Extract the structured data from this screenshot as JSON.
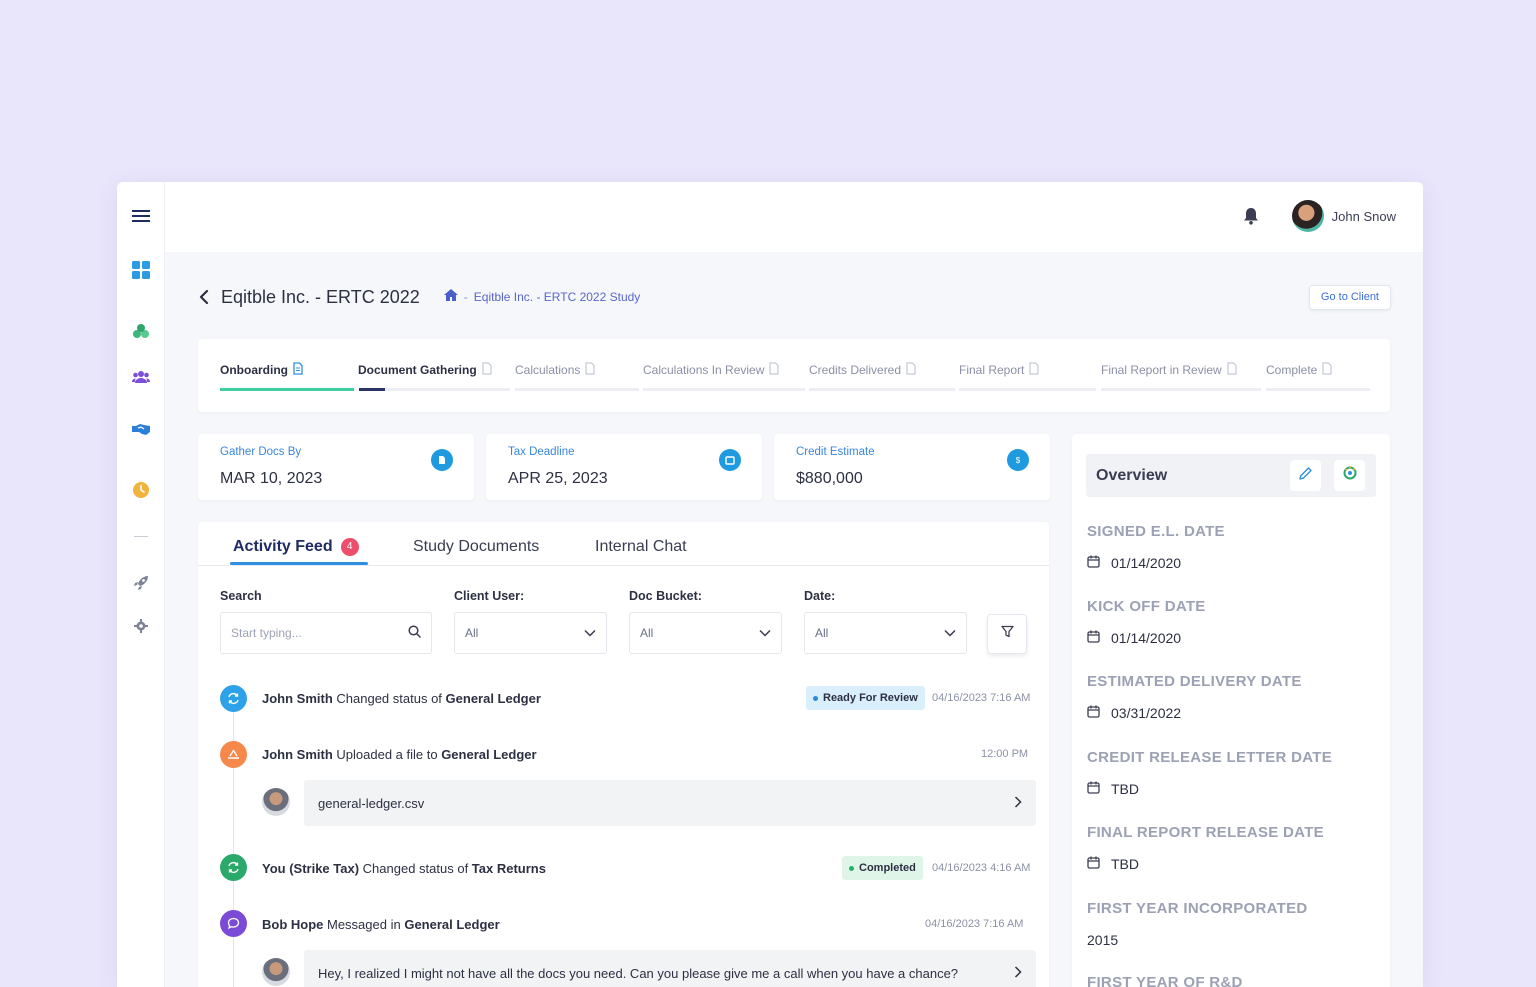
{
  "user": {
    "name": "John Snow"
  },
  "page": {
    "title": "Eqitble Inc. - ERTC 2022",
    "breadcrumb_sep": "-",
    "breadcrumb_link": "Eqitble Inc. - ERTC 2022 Study",
    "go_to_client": "Go to Client"
  },
  "sidebar": {
    "items": [
      "menu-icon",
      "dashboard-icon",
      "money-icon",
      "users-icon",
      "handshake-icon",
      "clock-icon",
      "rocket-icon",
      "settings-icon"
    ]
  },
  "stepper": {
    "steps": [
      {
        "label": "Onboarding",
        "state": "complete",
        "progress": 1.0
      },
      {
        "label": "Document Gathering",
        "state": "active",
        "progress": 0.17
      },
      {
        "label": "Calculations",
        "state": "pending",
        "progress": 0
      },
      {
        "label": "Calculations In Review",
        "state": "pending",
        "progress": 0
      },
      {
        "label": "Credits Delivered",
        "state": "pending",
        "progress": 0
      },
      {
        "label": "Final Report",
        "state": "pending",
        "progress": 0
      },
      {
        "label": "Final Report in Review",
        "state": "pending",
        "progress": 0
      },
      {
        "label": "Complete",
        "state": "pending",
        "progress": 0
      }
    ]
  },
  "cards": [
    {
      "label": "Gather Docs By",
      "value": "MAR 10, 2023",
      "icon": "document-icon"
    },
    {
      "label": "Tax Deadline",
      "value": "APR 25, 2023",
      "icon": "calendar-icon"
    },
    {
      "label": "Credit Estimate",
      "value": "$880,000",
      "icon": "dollar-icon",
      "icon_text": "$"
    }
  ],
  "feed": {
    "tabs": [
      {
        "label": "Activity Feed",
        "count": "4",
        "active": true
      },
      {
        "label": "Study Documents"
      },
      {
        "label": "Internal Chat"
      }
    ],
    "filters": {
      "search_label": "Search",
      "search_placeholder": "Start typing...",
      "client_user_label": "Client User:",
      "client_user_value": "All",
      "doc_bucket_label": "Doc Bucket:",
      "doc_bucket_value": "All",
      "date_label": "Date:",
      "date_value": "All"
    },
    "entries": [
      {
        "actor": "John Smith",
        "action": " Changed status of ",
        "target": "General Ledger",
        "status": "Ready For Review",
        "time": "04/16/2023 7:16 AM",
        "color": "#2ea2e8"
      },
      {
        "actor": "John Smith",
        "action": " Uploaded a file to ",
        "target": "General Ledger",
        "time": "12:00 PM",
        "attachment": "general-ledger.csv",
        "color": "#f5884a"
      },
      {
        "actor": "You (Strike Tax)",
        "action": " Changed status of ",
        "target": "Tax Returns",
        "status": "Completed",
        "time": "04/16/2023 4:16 AM",
        "color": "#2aa96a"
      },
      {
        "actor": "Bob Hope",
        "action": " Messaged in ",
        "target": "General Ledger",
        "time": "04/16/2023 7:16 AM",
        "message": "Hey, I realized I might not have all the docs you need. Can you please give me a call when you have a chance?",
        "color": "#7a4bd6"
      }
    ]
  },
  "overview": {
    "title": "Overview",
    "fields": [
      {
        "label": "SIGNED E.L. DATE",
        "value": "01/14/2020",
        "calendar": true
      },
      {
        "label": "KICK OFF DATE",
        "value": "01/14/2020",
        "calendar": true
      },
      {
        "label": "ESTIMATED DELIVERY DATE",
        "value": "03/31/2022",
        "calendar": true
      },
      {
        "label": "CREDIT RELEASE LETTER DATE",
        "value": "TBD",
        "calendar": true
      },
      {
        "label": "FINAL REPORT RELEASE DATE",
        "value": "TBD",
        "calendar": true
      },
      {
        "label": "FIRST YEAR INCORPORATED",
        "value": "2015",
        "calendar": false
      },
      {
        "label": "FIRST YEAR OF R&D"
      }
    ]
  },
  "colors": {
    "accent": "#2f8fe3",
    "onboarding_bar": "#3fcf9c",
    "active_bar": "#2a3566",
    "ready_pill": "#d9effc",
    "completed_pill": "#dff5e8"
  }
}
